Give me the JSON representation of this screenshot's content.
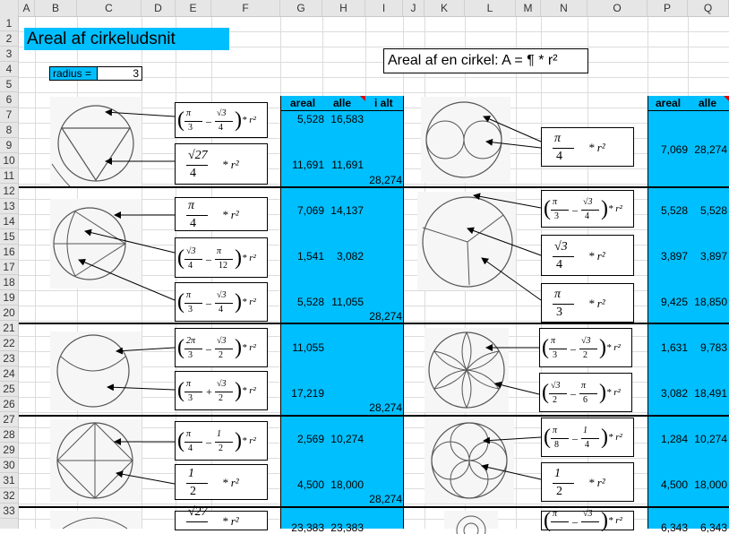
{
  "sheet": {
    "columns": [
      "A",
      "B",
      "C",
      "D",
      "E",
      "F",
      "G",
      "H",
      "I",
      "J",
      "K",
      "L",
      "M",
      "N",
      "O",
      "P",
      "Q"
    ],
    "rows": [
      "1",
      "2",
      "3",
      "4",
      "5",
      "6",
      "7",
      "8",
      "9",
      "10",
      "11",
      "12",
      "13",
      "14",
      "15",
      "16",
      "17",
      "18",
      "19",
      "20",
      "21",
      "22",
      "23",
      "24",
      "25",
      "26",
      "27",
      "28",
      "29",
      "30",
      "31",
      "32",
      "33"
    ]
  },
  "title": "Areal af cirkeludsnit",
  "radius": {
    "label": "radius =",
    "value": "3"
  },
  "formula_box": "Areal af en cirkel: A = ¶ * r²",
  "table_left": {
    "h1": "areal",
    "h2": "alle",
    "h3": "i alt"
  },
  "table_right": {
    "h1": "areal",
    "h2": "alle"
  },
  "left_values": [
    {
      "a": "5,528",
      "b": "16,583"
    },
    {
      "a": "11,691",
      "b": "11,691"
    },
    {
      "total": "28,274"
    },
    {
      "a": "7,069",
      "b": "14,137"
    },
    {
      "a": "1,541",
      "b": "3,082"
    },
    {
      "a": "5,528",
      "b": "11,055"
    },
    {
      "total": "28,274"
    },
    {
      "a": "11,055"
    },
    {
      "a": "17,219"
    },
    {
      "total": "28,274"
    },
    {
      "a": "2,569",
      "b": "10,274"
    },
    {
      "a": "4,500",
      "b": "18,000"
    },
    {
      "total": "28,274"
    },
    {
      "a": "23,383",
      "b": "23,383"
    }
  ],
  "right_values": [
    {
      "a": "7,069",
      "b": "28,274"
    },
    {
      "a": "5,528",
      "b": "5,528"
    },
    {
      "a": "3,897",
      "b": "3,897"
    },
    {
      "a": "9,425",
      "b": "18,850"
    },
    {
      "a": "1,631",
      "b": "9,783"
    },
    {
      "a": "3,082",
      "b": "18,491"
    },
    {
      "a": "1,284",
      "b": "10,274"
    },
    {
      "a": "4,500",
      "b": "18,000"
    },
    {
      "a": "6,343",
      "b": "6,343"
    }
  ],
  "formulas": {
    "f1": {
      "n1": "π",
      "d1": "3",
      "n2": "√3",
      "d2": "4",
      "tail": "* r²"
    },
    "f2": {
      "n1": "√27",
      "d1": "4",
      "tail": "* r²"
    },
    "f3": {
      "n1": "π",
      "d1": "4",
      "tail": "* r²"
    },
    "f4": {
      "n1": "√3",
      "d1": "4",
      "n2": "π",
      "d2": "12",
      "tail": "* r²"
    },
    "f5": {
      "n1": "π",
      "d1": "3",
      "n2": "√3",
      "d2": "4",
      "tail": "* r²"
    },
    "f6": {
      "n1": "2π",
      "d1": "3",
      "n2": "√3",
      "d2": "2",
      "tail": "* r²"
    },
    "f7": {
      "n1": "π",
      "d1": "3",
      "n2": "√3",
      "d2": "2",
      "tail": "* r²"
    },
    "f8": {
      "n1": "π",
      "d1": "4",
      "n2": "1",
      "d2": "2",
      "tail": "* r²"
    },
    "f9": {
      "n1": "1",
      "d1": "2",
      "tail": "* r²"
    },
    "f10": {
      "n1": "√27",
      "d1": "",
      "tail": "* r²"
    },
    "r1": {
      "n1": "π",
      "d1": "4",
      "tail": "* r²"
    },
    "r2": {
      "n1": "π",
      "d1": "3",
      "n2": "√3",
      "d2": "4",
      "tail": "* r²"
    },
    "r3": {
      "n1": "√3",
      "d1": "4",
      "tail": "* r²"
    },
    "r4": {
      "n1": "π",
      "d1": "3",
      "tail": "* r²"
    },
    "r5": {
      "n1": "π",
      "d1": "3",
      "n2": "√3",
      "d2": "2",
      "tail": "* r²"
    },
    "r6": {
      "n1": "√3",
      "d1": "2",
      "n2": "π",
      "d2": "6",
      "tail": "* r²"
    },
    "r7": {
      "n1": "π",
      "d1": "8",
      "n2": "1",
      "d2": "4",
      "tail": "* r²"
    },
    "r8": {
      "n1": "1",
      "d1": "2",
      "tail": "* r²"
    },
    "r9": {
      "n1": "π",
      "d1": "",
      "n2": "√3",
      "d2": "",
      "tail": "* r²"
    }
  },
  "ops": {
    "minus": "–",
    "plus": "+"
  },
  "colors": {
    "accent": "#00bfff",
    "comment": "#e00000"
  }
}
